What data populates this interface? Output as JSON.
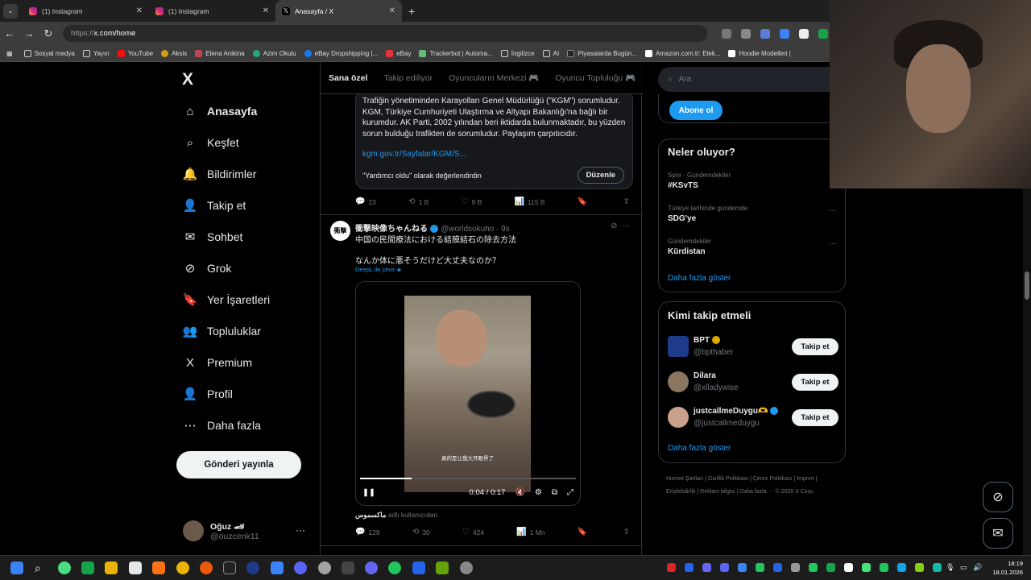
{
  "browser": {
    "tabs": [
      {
        "label": "(1) Instagram",
        "icon": "instagram-icon"
      },
      {
        "label": "(1) Instagram",
        "icon": "instagram-icon"
      },
      {
        "label": "Anasayfa / X",
        "icon": "x-icon"
      }
    ],
    "url_prefix": "https://",
    "url_main": "x.com/home",
    "bookmarks": [
      "Sosyal medya",
      "Yayın",
      "YouTube",
      "Aksis",
      "Elena Anikina",
      "Azim Okulu",
      "eBay Dropshipping |...",
      "eBay",
      "Trackerbot | Automa...",
      "İngilizce",
      "AI",
      "Piyasalarda Bugün...",
      "Amazon.com.tr: Elek...",
      "Hoodie Modelleri |"
    ]
  },
  "sidebar": {
    "logo": "X",
    "items": [
      {
        "label": "Anasayfa",
        "icon": "home-icon",
        "glyph": "⌂"
      },
      {
        "label": "Keşfet",
        "icon": "search-icon",
        "glyph": "⌕"
      },
      {
        "label": "Bildirimler",
        "icon": "bell-icon",
        "glyph": "🔔"
      },
      {
        "label": "Takip et",
        "icon": "follow-icon",
        "glyph": "👤"
      },
      {
        "label": "Sohbet",
        "icon": "mail-icon",
        "glyph": "✉"
      },
      {
        "label": "Grok",
        "icon": "grok-icon",
        "glyph": "⊘"
      },
      {
        "label": "Yer İşaretleri",
        "icon": "bookmark-icon",
        "glyph": "🔖"
      },
      {
        "label": "Topluluklar",
        "icon": "communities-icon",
        "glyph": "👥"
      },
      {
        "label": "Premium",
        "icon": "premium-icon",
        "glyph": "X"
      },
      {
        "label": "Profil",
        "icon": "profile-icon",
        "glyph": "👤"
      },
      {
        "label": "Daha fazla",
        "icon": "more-circle-icon",
        "glyph": "⋯"
      }
    ],
    "post_button": "Gönderi yayınla",
    "user": {
      "name": "Oğuz 🏎",
      "handle": "@ouzcenk11"
    }
  },
  "feed": {
    "tabs": [
      "Sana özel",
      "Takip ediliyor",
      "Oyuncuların Merkezi 🎮",
      "Oyuncu Topluluğu 🎮"
    ],
    "community_note": {
      "text": "Trafiğin yönetiminden Karayolları Genel Müdürlüğü (\"KGM\") sorumludur. KGM, Türkiye Cumhuriyeti Ulaştırma ve Altyapı Bakanlığı'na bağlı bir kurumdur. AK Parti, 2002 yılından beri iktidarda bulunmaktadır, bu yüzden sorun bulduğu trafikten de sorumludur. Paylaşım çarpıtıcıdır.",
      "link": "kgm.gov.tr/Sayfalar/KGM/S...",
      "footer": "\"Yardımcı oldu\" olarak değerlendirdin",
      "edit_button": "Düzenle"
    },
    "first_actions": {
      "replies": "23",
      "reposts": "1 B",
      "likes": "9 B",
      "views": "115 B"
    },
    "tweet": {
      "avatar_text": "衝撃",
      "name": "衝撃映像ちゃんねる",
      "handle": "@worldsokuho",
      "time": "· 9s",
      "text1": "中国の民間療法における結膜結石の除去方法",
      "text2": "なんか体に悪そうだけど大丈夫なのか？",
      "translate": "DeepL ile çevir",
      "video": {
        "subtitle": "真的是让我大开眼界了",
        "time": "0:04 / 0:17",
        "progress": 0.24
      },
      "footer_user": "ماكسموس",
      "footer_text": "adlı kullanıcıdan",
      "actions": {
        "replies": "129",
        "reposts": "30",
        "likes": "424",
        "views": "1 Mn"
      }
    }
  },
  "right": {
    "search_placeholder": "Ara",
    "subscribe": "Abone ol",
    "trends_title": "Neler oluyor?",
    "trends": [
      {
        "meta": "Spor · Gündemdekiler",
        "name": "#KSvTS"
      },
      {
        "meta": "Türkiye tarihinde gündemde",
        "name": "SDG'ye"
      },
      {
        "meta": "Gündemdekiler",
        "name": "Kürdistan"
      }
    ],
    "trends_more": "Daha fazla göster",
    "who_title": "Kimi takip etmeli",
    "who": [
      {
        "name": "BPT",
        "handle": "@bpthaber",
        "button": "Takip et",
        "avatar_color": "#1e3a8a"
      },
      {
        "name": "Dilara",
        "handle": "@xlladywise",
        "button": "Takip et",
        "avatar_color": "#8a7560"
      },
      {
        "name": "justcallmeDuygu🫶",
        "handle": "@justcallmeduygu",
        "button": "Takip et",
        "avatar_color": "#c9a18a"
      }
    ],
    "who_more": "Daha fazla göster",
    "footer": "Hizmet Şartları | Gizlilik Politikası | Çerez Politikası | İmprint | Erişilebilirlik | Reklam bilgisi | Daha fazla ··· © 2026 X Corp."
  },
  "taskbar": {
    "time": "18:19",
    "date": "18.01.2026"
  },
  "colors": {
    "accent": "#1d9bf0",
    "bg": "#000000",
    "border": "#2f3336"
  }
}
